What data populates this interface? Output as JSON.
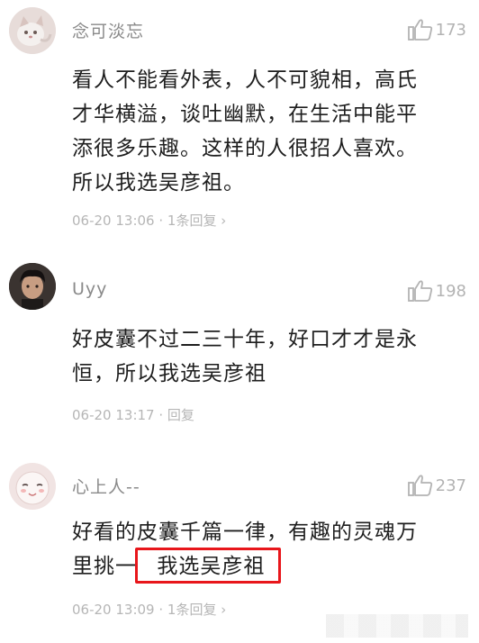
{
  "comments": [
    {
      "user": "念可淡忘",
      "likes": "173",
      "lines": [
        "看人不能看外表，人不可貌相，高氏",
        "才华横溢，谈吐幽默，在生活中能平",
        "添很多乐趣。这样的人很招人喜欢。",
        "所以我选吴彦祖。"
      ],
      "time": "06-20 13:06",
      "reply": "1条回复",
      "avatar": "cat-avatar"
    },
    {
      "user": "Uyy",
      "likes": "198",
      "lines": [
        "好皮囊不过二三十年，好口才才是永",
        "恒，所以我选吴彦祖"
      ],
      "time": "06-20 13:17",
      "reply": "回复",
      "avatar": "person-avatar"
    },
    {
      "user": "心上人--",
      "likes": "237",
      "lines": [
        "好看的皮囊千篇一律，有趣的灵魂万",
        "里挑一"
      ],
      "highlight": "我选吴彦祖",
      "time": "06-20 13:09",
      "reply": "1条回复",
      "avatar": "cartoon-face-avatar"
    }
  ],
  "colors": {
    "highlight_border": "#e8161b",
    "meta_text": "#b6b6b6",
    "name_text": "#8a8a8a"
  }
}
